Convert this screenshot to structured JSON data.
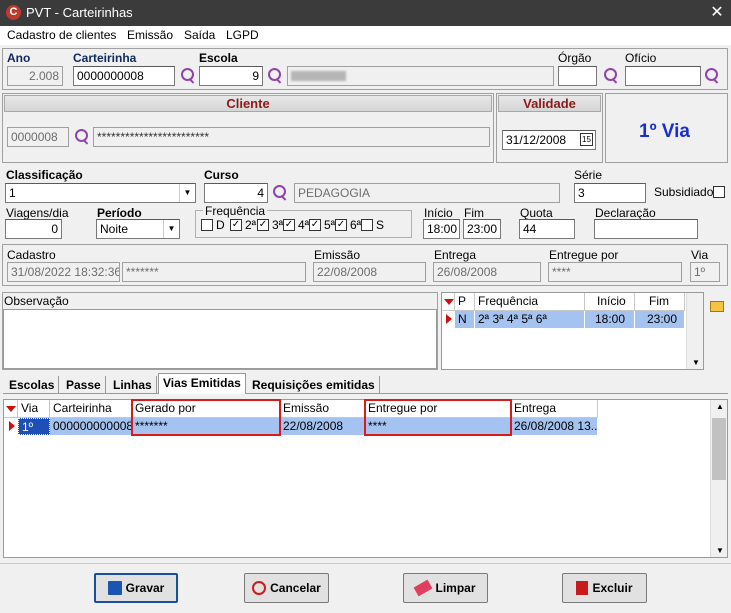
{
  "window": {
    "title": "PVT - Carteirinhas",
    "logo": "C",
    "close": "✕"
  },
  "menu": [
    "Cadastro de clientes",
    "Emissão",
    "Saída",
    "LGPD"
  ],
  "header": {
    "ano_label": "Ano",
    "ano_value": "2.008",
    "carteirinha_label": "Carteirinha",
    "carteirinha_value": "0000000008",
    "escola_label": "Escola",
    "escola_value": "9",
    "orgao_label": "Órgão",
    "oficio_label": "Ofício"
  },
  "cliente": {
    "label": "Cliente",
    "code": "0000008",
    "name": "************************"
  },
  "validade": {
    "label": "Validade",
    "value": "31/12/2008",
    "via_text": "1º Via"
  },
  "course": {
    "classificacao_label": "Classificação",
    "classificacao_value": "1",
    "curso_label": "Curso",
    "curso_code": "4",
    "curso_name": "PEDAGOGIA",
    "serie_label": "Série",
    "serie_value": "3",
    "subsidiado_label": "Subsidiado"
  },
  "trip": {
    "viagens_label": "Viagens/dia",
    "viagens_value": "0",
    "periodo_label": "Período",
    "periodo_value": "Noite",
    "frequencia_label": "Frequência",
    "days": [
      {
        "label": "D",
        "checked": false
      },
      {
        "label": "2ª",
        "checked": true
      },
      {
        "label": "3ª",
        "checked": true
      },
      {
        "label": "4ª",
        "checked": true
      },
      {
        "label": "5ª",
        "checked": true
      },
      {
        "label": "6ª",
        "checked": true
      },
      {
        "label": "S",
        "checked": false
      }
    ],
    "inicio_label": "Início",
    "inicio_value": "18:00",
    "fim_label": "Fim",
    "fim_value": "23:00",
    "quota_label": "Quota",
    "quota_value": "44",
    "declaracao_label": "Declaração"
  },
  "record": {
    "cadastro_label": "Cadastro",
    "cadastro_value": "31/08/2022 18:32:36",
    "cadastro_user": "*******",
    "emissao_label": "Emissão",
    "emissao_value": "22/08/2008",
    "entrega_label": "Entrega",
    "entrega_value": "26/08/2008",
    "entregue_label": "Entregue por",
    "entregue_value": "****",
    "via_label": "Via",
    "via_value": "1º"
  },
  "observacao_label": "Observação",
  "freq_grid": {
    "headers": [
      "P",
      "Frequência",
      "Início",
      "Fim"
    ],
    "row": {
      "p": "N",
      "freq": "2ª 3ª 4ª 5ª 6ª",
      "inicio": "18:00",
      "fim": "23:00"
    }
  },
  "tabs": [
    "Escolas",
    "Passe",
    "Linhas",
    "Vias Emitidas",
    "Requisições emitidas"
  ],
  "vias_grid": {
    "headers": [
      "Via",
      "Carteirinha",
      "Gerado por",
      "Emissão",
      "Entregue por",
      "Entrega"
    ],
    "row": {
      "via": "1º",
      "carteirinha": "000000000008",
      "gerado": "*******",
      "emissao": "22/08/2008",
      "entregue": "****",
      "entrega": "26/08/2008 13..."
    }
  },
  "buttons": {
    "gravar": "Gravar",
    "cancelar": "Cancelar",
    "limpar": "Limpar",
    "excluir": "Excluir"
  }
}
